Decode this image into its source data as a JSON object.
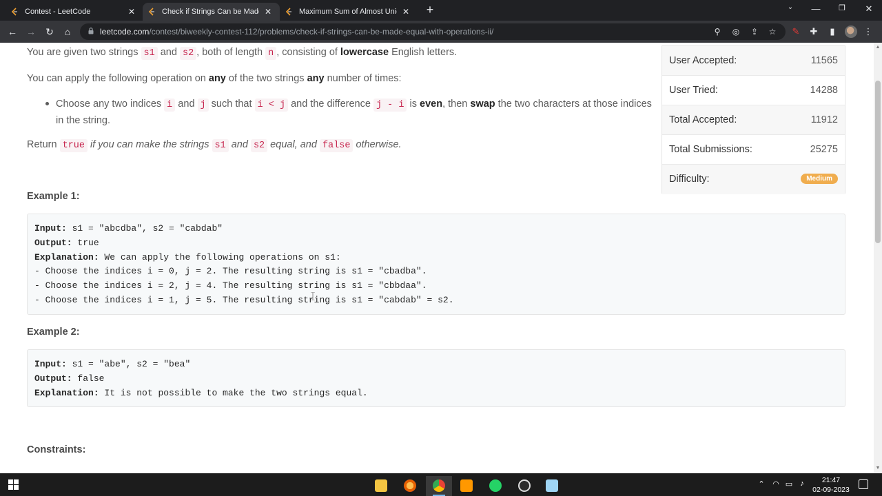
{
  "browser": {
    "tabs": [
      {
        "title": "Contest - LeetCode"
      },
      {
        "title": "Check if Strings Can be Made Eq"
      },
      {
        "title": "Maximum Sum of Almost Unique"
      }
    ],
    "new_tab": "+",
    "url_host": "leetcode.com",
    "url_path": "/contest/biweekly-contest-112/problems/check-if-strings-can-be-made-equal-with-operations-ii/"
  },
  "problem": {
    "p1": {
      "t1": "You are given two strings ",
      "c1": "s1",
      "t2": " and ",
      "c2": "s2",
      "t3": ", both of length ",
      "c3": "n",
      "t4": ", consisting of ",
      "b1": "lowercase",
      "t5": " English letters."
    },
    "p2": {
      "t1": "You can apply the following operation on ",
      "b1": "any",
      "t2": " of the two strings ",
      "b2": "any",
      "t3": " number of times:"
    },
    "bullet": {
      "t1": "Choose any two indices ",
      "c1": "i",
      "t2": " and ",
      "c2": "j",
      "t3": " such that ",
      "c3": "i < j",
      "t4": " and the difference ",
      "c4": "j - i",
      "t5": " is ",
      "b1": "even",
      "t6": ", then ",
      "b2": "swap",
      "t7": " the two characters at those indices in the string."
    },
    "p3": {
      "t1": "Return ",
      "c1": "true",
      "t2": " if you can make the strings ",
      "c2": "s1",
      "t3": " and ",
      "c3": "s2",
      "t4": " equal, and ",
      "c4": "false",
      "t5": " otherwise."
    },
    "example1": {
      "title": "Example 1:",
      "input_label": "Input:",
      "input": " s1 = \"abcdba\", s2 = \"cabdab\"",
      "output_label": "Output:",
      "output": " true",
      "explanation_label": "Explanation:",
      "explanation": " We can apply the following operations on s1:",
      "lines": [
        "- Choose the indices i = 0, j = 2. The resulting string is s1 = \"cbadba\".",
        "- Choose the indices i = 2, j = 4. The resulting string is s1 = \"cbbdaa\".",
        "- Choose the indices i = 1, j = 5. The resulting string is s1 = \"cabdab\" = s2."
      ]
    },
    "example2": {
      "title": "Example 2:",
      "input_label": "Input:",
      "input": " s1 = \"abe\", s2 = \"bea\"",
      "output_label": "Output:",
      "output": " false",
      "explanation_label": "Explanation:",
      "explanation": " It is not possible to make the two strings equal."
    },
    "constraints_title": "Constraints:"
  },
  "stats": {
    "rows": [
      {
        "label": "User Accepted:",
        "value": "11565"
      },
      {
        "label": "User Tried:",
        "value": "14288"
      },
      {
        "label": "Total Accepted:",
        "value": "11912"
      },
      {
        "label": "Total Submissions:",
        "value": "25275"
      }
    ],
    "difficulty_label": "Difficulty:",
    "difficulty": "Medium",
    "difficulty_color": "#f0ad4e"
  },
  "taskbar": {
    "time": "21:47",
    "date": "02-09-2023"
  }
}
